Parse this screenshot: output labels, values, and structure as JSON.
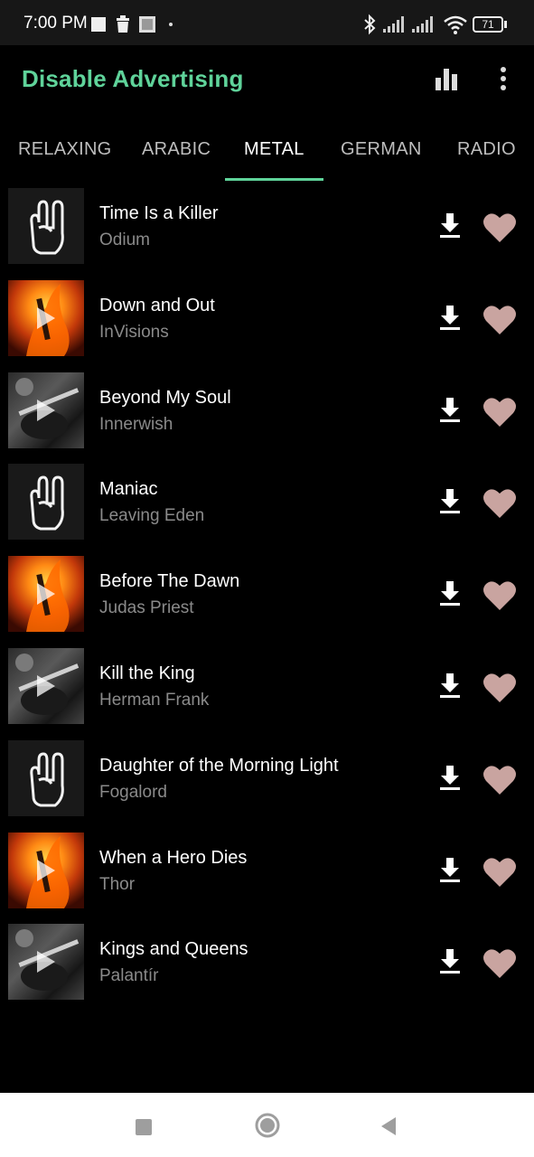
{
  "status_bar": {
    "time": "7:00 PM",
    "battery": "71"
  },
  "app_bar": {
    "title": "Disable Advertising",
    "accent_color": "#5fd39a",
    "icons": [
      "equalizer-icon",
      "more-vert-icon"
    ]
  },
  "tabs": [
    {
      "label": "RELAXING",
      "active": false
    },
    {
      "label": "ARABIC",
      "active": false
    },
    {
      "label": "METAL",
      "active": true
    },
    {
      "label": "GERMAN",
      "active": false
    },
    {
      "label": "RADIO",
      "active": false
    }
  ],
  "songs": [
    {
      "title": "Time Is a Killer",
      "artist": "Odium",
      "thumb": "rock-hand"
    },
    {
      "title": "Down and Out",
      "artist": "InVisions",
      "thumb": "fire-guitar"
    },
    {
      "title": "Beyond My Soul",
      "artist": "Innerwish",
      "thumb": "guitarist"
    },
    {
      "title": "Maniac",
      "artist": "Leaving Eden",
      "thumb": "rock-hand"
    },
    {
      "title": "Before The Dawn",
      "artist": "Judas Priest",
      "thumb": "fire-guitar"
    },
    {
      "title": "Kill the King",
      "artist": "Herman Frank",
      "thumb": "guitarist"
    },
    {
      "title": "Daughter of the Morning Light",
      "artist": "Fogalord",
      "thumb": "rock-hand"
    },
    {
      "title": "When a Hero Dies",
      "artist": "Thor",
      "thumb": "fire-guitar"
    },
    {
      "title": "Kings and Queens",
      "artist": "Palantír",
      "thumb": "guitarist"
    }
  ],
  "colors": {
    "heart": "#c9a4a0",
    "artist_text": "#8a8a8a"
  }
}
